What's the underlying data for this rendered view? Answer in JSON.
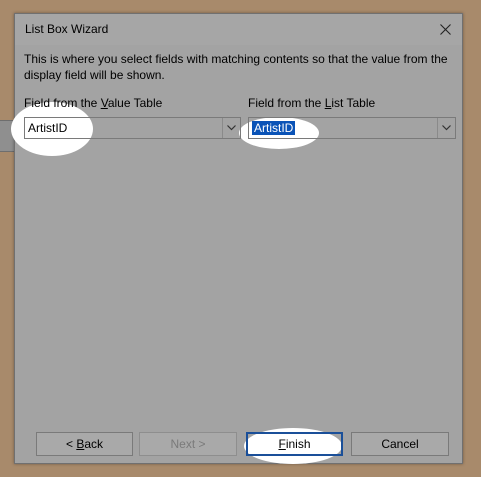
{
  "dialog": {
    "title": "List Box Wizard",
    "description": "This is where you select fields with matching contents so that the value from the display field will be shown."
  },
  "value_field": {
    "label_pre": "Field from the ",
    "label_accel": "V",
    "label_post": "alue Table",
    "selected": "ArtistID"
  },
  "list_field": {
    "label_pre": "Field from the ",
    "label_accel": "L",
    "label_post": "ist Table",
    "selected": "ArtistID"
  },
  "buttons": {
    "back_pre": "< ",
    "back_accel": "B",
    "back_post": "ack",
    "next": "Next >",
    "finish_accel": "F",
    "finish_post": "inish",
    "cancel": "Cancel"
  },
  "colors": {
    "dialog_bg": "#a3a3a3",
    "selection": "#0a53b7",
    "default_button_border": "#1a4f99"
  }
}
